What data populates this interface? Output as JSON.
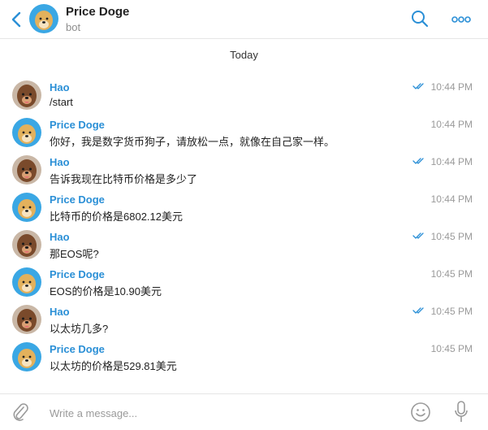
{
  "colors": {
    "accent": "#2a8fd6",
    "time": "#9a9a9a",
    "doge_bg": "#3aa7e4",
    "doge_face": "#e3b15c",
    "hao_face": "#7a4a2b"
  },
  "header": {
    "title": "Price Doge",
    "subtitle": "bot",
    "back_icon": "chevron-left-icon",
    "search_icon": "search-icon",
    "more_icon": "more-dots-icon"
  },
  "date_separator": "Today",
  "messages": [
    {
      "sender": "Hao",
      "text": "/start",
      "time": "10:44 PM",
      "read": true,
      "avatar": "hao"
    },
    {
      "sender": "Price Doge",
      "text": "你好，我是数字货币狗子，请放松一点，就像在自己家一样。",
      "time": "10:44 PM",
      "read": false,
      "avatar": "doge"
    },
    {
      "sender": "Hao",
      "text": "告诉我现在比特币价格是多少了",
      "time": "10:44 PM",
      "read": true,
      "avatar": "hao"
    },
    {
      "sender": "Price Doge",
      "text": "比特币的价格是6802.12美元",
      "time": "10:44 PM",
      "read": false,
      "avatar": "doge"
    },
    {
      "sender": "Hao",
      "text": "那EOS呢?",
      "time": "10:45 PM",
      "read": true,
      "avatar": "hao"
    },
    {
      "sender": "Price Doge",
      "text": "EOS的价格是10.90美元",
      "time": "10:45 PM",
      "read": false,
      "avatar": "doge"
    },
    {
      "sender": "Hao",
      "text": "以太坊几多?",
      "time": "10:45 PM",
      "read": true,
      "avatar": "hao"
    },
    {
      "sender": "Price Doge",
      "text": "以太坊的价格是529.81美元",
      "time": "10:45 PM",
      "read": false,
      "avatar": "doge"
    }
  ],
  "composer": {
    "placeholder": "Write a message...",
    "attach_icon": "paperclip-icon",
    "emoji_icon": "emoji-icon",
    "mic_icon": "microphone-icon"
  }
}
